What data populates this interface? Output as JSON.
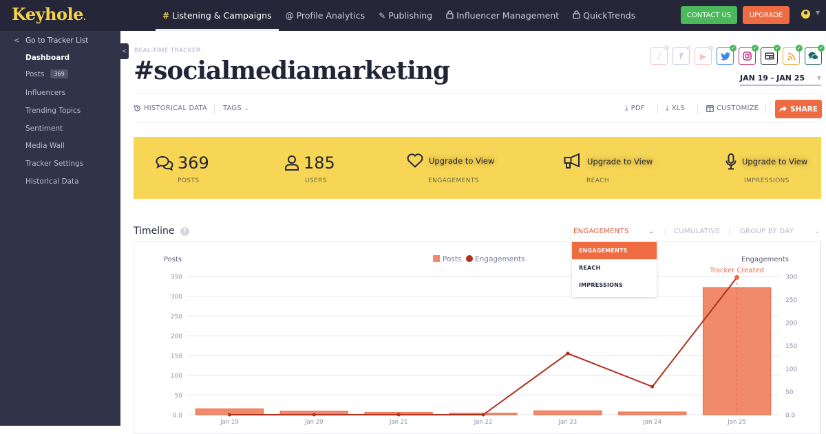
{
  "app": {
    "logo": "Keyhole"
  },
  "nav": {
    "items": [
      {
        "icon": "hash-icon",
        "glyph": "#",
        "label": "Listening & Campaigns",
        "active": true
      },
      {
        "icon": "at-icon",
        "glyph": "@",
        "label": "Profile Analytics"
      },
      {
        "icon": "pen-icon",
        "glyph": "✎",
        "label": "Publishing"
      },
      {
        "icon": "lock-icon",
        "glyph": "🔒",
        "label": "Influencer Management"
      },
      {
        "icon": "lock-icon",
        "glyph": "🔒",
        "label": "QuickTrends"
      }
    ],
    "contact_label": "CONTACT US",
    "upgrade_label": "UPGRADE"
  },
  "sidebar": {
    "back_label": "Go to Tracker List",
    "items": [
      {
        "label": "Dashboard",
        "active": true
      },
      {
        "label": "Posts",
        "badge": "369"
      },
      {
        "label": "Influencers"
      },
      {
        "label": "Trending Topics"
      },
      {
        "label": "Sentiment"
      },
      {
        "label": "Media Wall"
      },
      {
        "label": "Tracker Settings"
      },
      {
        "label": "Historical Data"
      }
    ]
  },
  "header": {
    "tracker_label": "REAL-TIME TRACKER:",
    "title": "#socialmediamarketing",
    "date_range": "JAN 19 - JAN 25",
    "networks": [
      {
        "name": "tiktok",
        "glyph": "♪",
        "color": "#e57a86",
        "enabled": false
      },
      {
        "name": "facebook",
        "glyph": "f",
        "color": "#7b8fc4",
        "enabled": false
      },
      {
        "name": "youtube",
        "glyph": "▶",
        "color": "#e57a7a",
        "enabled": false
      },
      {
        "name": "twitter",
        "glyph": "🐦",
        "color": "#3c8ae6",
        "enabled": true
      },
      {
        "name": "instagram",
        "glyph": "◎",
        "color": "#c6297f",
        "enabled": true
      },
      {
        "name": "news",
        "glyph": "▤",
        "color": "#333",
        "enabled": true
      },
      {
        "name": "rss",
        "glyph": "〜",
        "color": "#f0a52a",
        "enabled": true
      },
      {
        "name": "forums",
        "glyph": "💬",
        "color": "#1e6b63",
        "enabled": true
      }
    ]
  },
  "toolbar": {
    "historical": "HISTORICAL DATA",
    "tags": "TAGS",
    "pdf": "PDF",
    "xls": "XLS",
    "customize": "CUSTOMIZE",
    "share": "SHARE"
  },
  "stats": [
    {
      "icon": "chat-icon",
      "value": "369",
      "label": "POSTS"
    },
    {
      "icon": "user-icon",
      "value": "185",
      "label": "USERS"
    },
    {
      "icon": "heart-icon",
      "value": "Upgrade to View",
      "label": "ENGAGEMENTS",
      "locked": true
    },
    {
      "icon": "megaphone-icon",
      "value": "Upgrade to View",
      "label": "REACH",
      "locked": true
    },
    {
      "icon": "microphone-icon",
      "value": "Upgrade to View",
      "label": "IMPRESSIONS",
      "locked": true
    }
  ],
  "timeline": {
    "title": "Timeline",
    "metric_selected": "ENGAGEMENTS",
    "cumulative": "CUMULATIVE",
    "group_by": "GROUP BY DAY",
    "dropdown_options": [
      "ENGAGEMENTS",
      "REACH",
      "IMPRESSIONS"
    ]
  },
  "chart_data": {
    "type": "bar",
    "categories": [
      "Jan 19",
      "Jan 20",
      "Jan 21",
      "Jan 22",
      "Jan 23",
      "Jan 24",
      "Jan 25"
    ],
    "series": [
      {
        "name": "Posts",
        "type": "bar",
        "axis": "left",
        "color": "#f08a6a",
        "values": [
          15,
          9,
          6,
          4,
          10,
          7,
          322
        ]
      },
      {
        "name": "Engagements",
        "type": "line",
        "axis": "right",
        "color": "#b0301c",
        "values": [
          0,
          0,
          0,
          0,
          133,
          61,
          298
        ]
      }
    ],
    "ylabel_left": "Posts",
    "ylabel_right": "Engagements",
    "ylim_left": [
      0,
      350
    ],
    "yticks_left": [
      "0.0",
      "50",
      "100",
      "150",
      "200",
      "250",
      "300",
      "350"
    ],
    "ylim_right": [
      0,
      300
    ],
    "yticks_right": [
      "0.0",
      "50",
      "100",
      "150",
      "200",
      "250",
      "300"
    ],
    "annotation": {
      "text": "Tracker Created",
      "category": "Jan 25",
      "color": "#ef6b42"
    },
    "legend": "top-center",
    "grid": true
  }
}
